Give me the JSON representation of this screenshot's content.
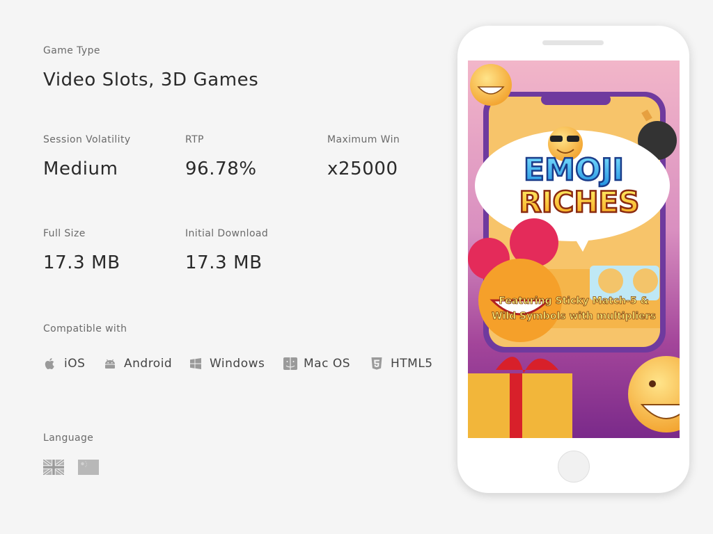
{
  "game_type": {
    "label": "Game Type",
    "value": "Video Slots, 3D Games"
  },
  "stats": {
    "volatility": {
      "label": "Session Volatility",
      "value": "Medium"
    },
    "rtp": {
      "label": "RTP",
      "value": "96.78%"
    },
    "max_win": {
      "label": "Maximum Win",
      "value": "x25000"
    },
    "full_size": {
      "label": "Full Size",
      "value": "17.3 MB"
    },
    "initial_download": {
      "label": "Initial Download",
      "value": "17.3 MB"
    }
  },
  "compatible": {
    "label": "Compatible with",
    "platforms": [
      {
        "name": "iOS",
        "icon": "apple-icon"
      },
      {
        "name": "Android",
        "icon": "android-icon"
      },
      {
        "name": "Windows",
        "icon": "windows-icon"
      },
      {
        "name": "Mac OS",
        "icon": "finder-icon"
      },
      {
        "name": "HTML5",
        "icon": "html5-icon"
      }
    ]
  },
  "language": {
    "label": "Language",
    "flags": [
      "uk-flag-icon",
      "china-flag-icon"
    ]
  },
  "promo": {
    "title_line1": "EMOJI",
    "title_line2": "RICHES",
    "tagline_line1": "Featuring Sticky Match-5 &",
    "tagline_line2": "Wild Symbols with multipliers"
  },
  "colors": {
    "icon_gray": "#9a9a9a",
    "background": "#f5f5f5"
  }
}
